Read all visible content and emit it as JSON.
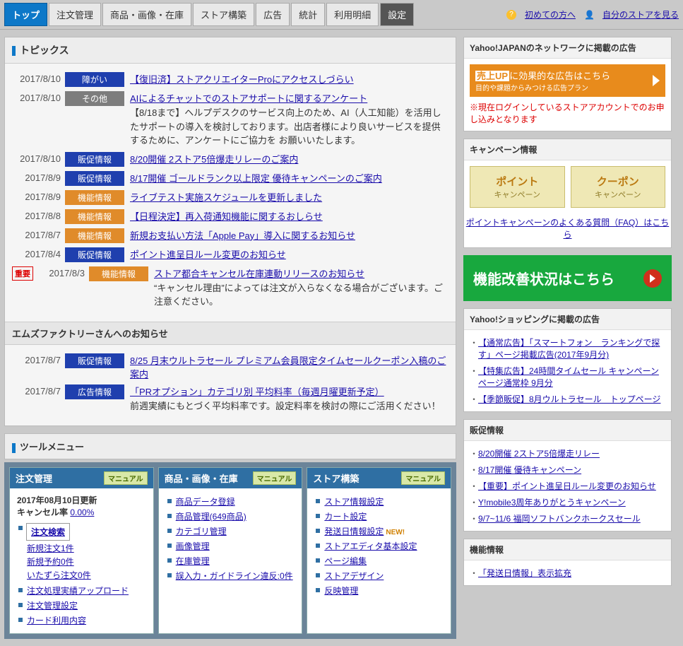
{
  "tabs": [
    "トップ",
    "注文管理",
    "商品・画像・在庫",
    "ストア構築",
    "広告",
    "統計",
    "利用明細",
    "設定"
  ],
  "topbar": {
    "help": "初めての方へ",
    "view_store": "自分のストアを見る"
  },
  "topics": {
    "title": "トピックス",
    "items": [
      {
        "date": "2017/8/10",
        "badge": "障がい",
        "badge_class": "badge-blue",
        "link": "【復旧済】ストアクリエイターProにアクセスしづらい",
        "desc": ""
      },
      {
        "date": "2017/8/10",
        "badge": "その他",
        "badge_class": "badge-gray",
        "link": "AIによるチャットでのストアサポートに関するアンケート",
        "desc": "【8/18まで】ヘルプデスクのサービス向上のため、AI（人工知能）を活用したサポートの導入を検討しております。出店者様により良いサービスを提供するために、アンケートにご協力を お願いいたします。"
      },
      {
        "date": "2017/8/10",
        "badge": "販促情報",
        "badge_class": "badge-blue",
        "link": "8/20開催 2ストア5倍爆走リレーのご案内",
        "desc": ""
      },
      {
        "date": "2017/8/9",
        "badge": "販促情報",
        "badge_class": "badge-blue",
        "link": "8/17開催 ゴールドランク以上限定 優待キャンペーンのご案内",
        "desc": ""
      },
      {
        "date": "2017/8/9",
        "badge": "機能情報",
        "badge_class": "badge-orange",
        "link": "ライブテスト実施スケジュールを更新しました",
        "desc": ""
      },
      {
        "date": "2017/8/8",
        "badge": "機能情報",
        "badge_class": "badge-orange",
        "link": "【日程決定】再入荷通知機能に関するおしらせ",
        "desc": ""
      },
      {
        "date": "2017/8/7",
        "badge": "機能情報",
        "badge_class": "badge-orange",
        "link": "新規お支払い方法「Apple Pay」導入に関するお知らせ",
        "desc": ""
      },
      {
        "date": "2017/8/4",
        "badge": "販促情報",
        "badge_class": "badge-blue",
        "link": "ポイント進呈日ルール変更のお知らせ",
        "desc": ""
      },
      {
        "date": "2017/8/3",
        "badge": "機能情報",
        "badge_class": "badge-orange",
        "link": "ストア都合キャンセル在庫連動リリースのお知らせ",
        "desc": "“キャンセル理由”によっては注文が入らなくなる場合がございます。ご注意ください。",
        "important": "重要"
      }
    ],
    "store_notice_header": "エムズファクトリーさんへのお知らせ",
    "store_items": [
      {
        "date": "2017/8/7",
        "badge": "販促情報",
        "badge_class": "badge-blue",
        "link": "8/25 月末ウルトラセール プレミアム会員限定タイムセールクーポン入稿のご案内",
        "desc": ""
      },
      {
        "date": "2017/8/7",
        "badge": "広告情報",
        "badge_class": "badge-blue",
        "link": "「PRオプション」カテゴリ別 平均料率（毎週月曜更新予定）",
        "desc": "前週実績にもとづく平均料率です。設定料率を検討の際にご活用ください！"
      }
    ]
  },
  "ad_panel": {
    "header": "Yahoo!JAPANのネットワークに掲載の広告",
    "banner_main": "売上UPに効果的な広告はこちら",
    "banner_sub": "目的や課題からみつける広告プラン",
    "note": "※現在ログインしているストアアカウントでのお申し込みとなります"
  },
  "campaign": {
    "header": "キャンペーン情報",
    "point": {
      "t1": "ポイント",
      "t2": "キャンペーン"
    },
    "coupon": {
      "t1": "クーポン",
      "t2": "キャンペーン"
    },
    "faq": "ポイントキャンペーンのよくある質問（FAQ）はこちら"
  },
  "green_banner": "機能改善状況はこちら",
  "shopping_ads": {
    "header": "Yahoo!ショッピングに掲載の広告",
    "items": [
      "【通常広告】「スマートフォン　ランキングで探す」ページ掲載広告(2017年9月分)",
      "【特集広告】24時間タイムセール キャンペーンページ通常枠 9月分",
      "【季節販促】8月ウルトラセール　トップページ"
    ]
  },
  "promo_info": {
    "header": "販促情報",
    "items": [
      "8/20開催 2ストア5倍爆走リレー",
      "8/17開催 優待キャンペーン",
      "【重要】ポイント進呈日ルール変更のお知らせ",
      "Y!mobile3周年ありがとうキャンペーン",
      "9/7~11/6 福岡ソフトバンクホークスセール"
    ]
  },
  "func_info": {
    "header": "機能情報",
    "items": [
      "「発送日情報」表示拡充"
    ]
  },
  "tool_menu": "ツールメニュー",
  "manual_label": "マニュアル",
  "tools": {
    "order": {
      "title": "注文管理",
      "updated": "2017年08月10日更新",
      "cancel_rate_label": "キャンセル率",
      "cancel_rate_value": "0.00%",
      "search": "注文検索",
      "new_orders": "新規注文1件",
      "new_reserve": "新規予約0件",
      "fraud": "いたずら注文0件",
      "upload": "注文処理実績アップロード",
      "settings": "注文管理設定",
      "card": "カード利用内容"
    },
    "product": {
      "title": "商品・画像・在庫",
      "items": [
        "商品データ登録",
        "商品管理(649商品)",
        "カテゴリ管理",
        "画像管理",
        "在庫管理",
        "誤入力・ガイドライン違反:0件"
      ]
    },
    "store": {
      "title": "ストア構築",
      "items": [
        "ストア情報設定",
        "カート設定",
        "発送日情報設定",
        "ストアエディタ基本設定",
        "ページ編集",
        "ストアデザイン",
        "反映管理"
      ]
    }
  }
}
